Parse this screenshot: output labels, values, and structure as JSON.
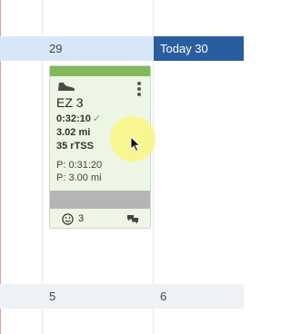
{
  "calendar": {
    "header": {
      "day_label": "29",
      "today_label": "Today 30"
    },
    "footer": {
      "day_a_label": "5",
      "day_b_label": "6"
    }
  },
  "workout": {
    "title": "EZ 3",
    "duration": "0:32:10",
    "distance": "3.02 mi",
    "tss": "35 rTSS",
    "planned_duration": "P: 0:31:20",
    "planned_distance": "P: 3.00 mi",
    "comment_count": "3",
    "sport_icon": "shoe-icon",
    "status_color": "#80b85a"
  },
  "colors": {
    "today_header": "#2a5d9e",
    "day_header": "#d8e7f8",
    "card_background": "#edf5e5"
  }
}
